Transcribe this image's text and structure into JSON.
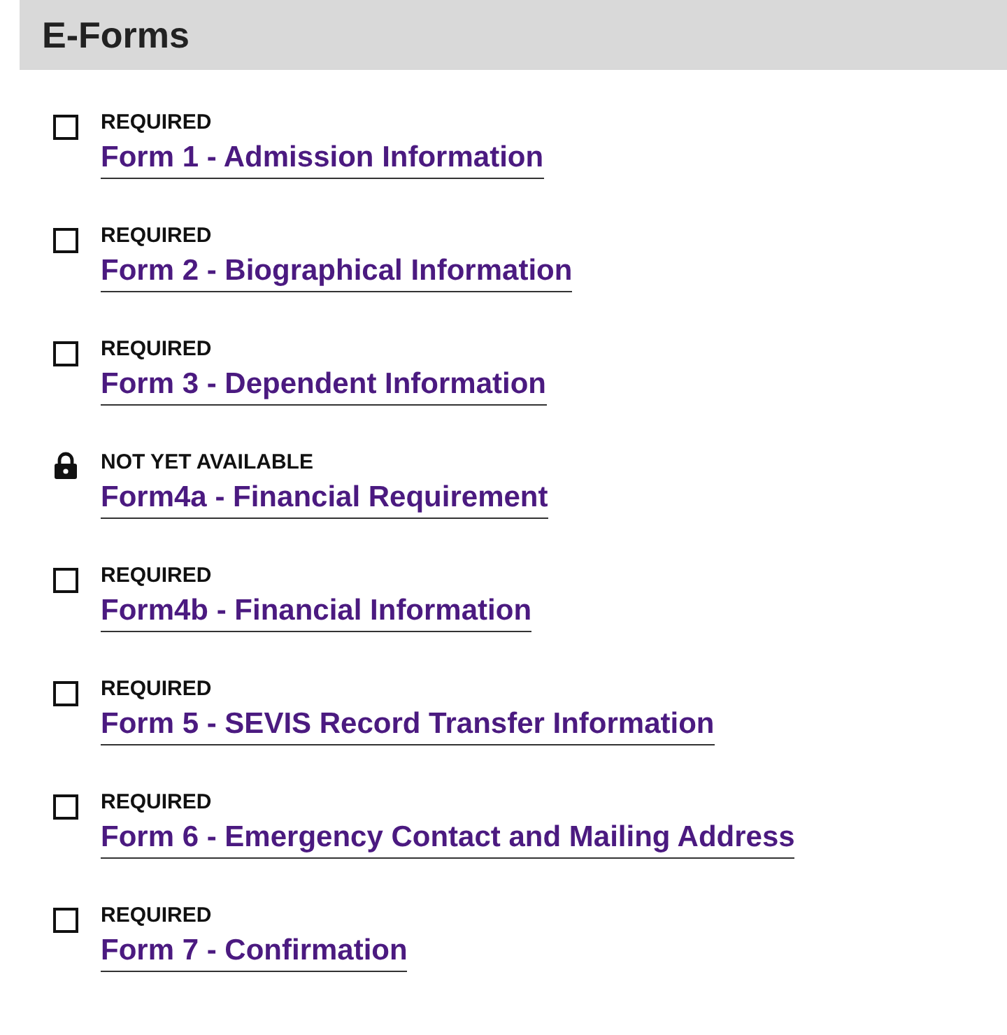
{
  "header": {
    "title": "E-Forms"
  },
  "forms": [
    {
      "kind": "checkbox",
      "checked": false,
      "status": "REQUIRED",
      "title": "Form 1 - Admission Information"
    },
    {
      "kind": "checkbox",
      "checked": false,
      "status": "REQUIRED",
      "title": "Form 2 - Biographical Information"
    },
    {
      "kind": "checkbox",
      "checked": false,
      "status": "REQUIRED",
      "title": "Form 3 - Dependent Information"
    },
    {
      "kind": "locked",
      "status": "NOT YET AVAILABLE",
      "title": "Form4a - Financial Requirement"
    },
    {
      "kind": "checkbox",
      "checked": false,
      "status": "REQUIRED",
      "title": "Form4b - Financial Information"
    },
    {
      "kind": "checkbox",
      "checked": false,
      "status": "REQUIRED",
      "title": "Form 5 - SEVIS Record Transfer Information"
    },
    {
      "kind": "checkbox",
      "checked": false,
      "status": "REQUIRED",
      "title": "Form 6 - Emergency Contact and Mailing Address"
    },
    {
      "kind": "checkbox",
      "checked": false,
      "status": "REQUIRED",
      "title": "Form 7 - Confirmation"
    }
  ]
}
